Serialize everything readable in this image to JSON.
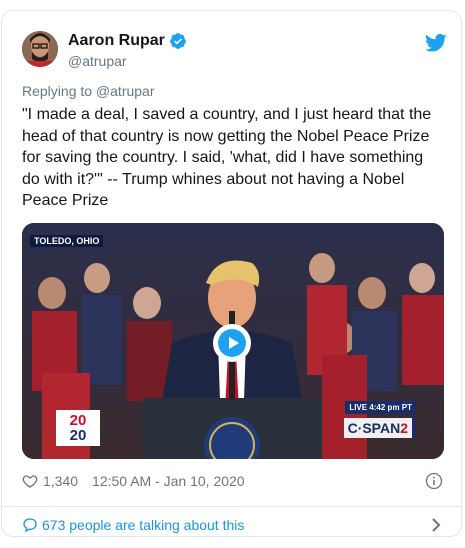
{
  "tweet": {
    "author_name": "Aaron Rupar",
    "author_handle": "@atrupar",
    "replying_to": "Replying to @atrupar",
    "text": "\"I made a deal, I saved a country, and I just heard that the head of that country is now getting the Nobel Peace Prize for saving the country. I said, 'what, did I have something do with it?'\" -- Trump whines about not having a Nobel Peace Prize",
    "likes": "1,340",
    "timestamp": "12:50 AM - Jan 10, 2020",
    "talking_link": "673 people are talking about this"
  },
  "media": {
    "location_label": "TOLEDO, OHIO",
    "live_label": "LIVE  4:42 pm PT",
    "network_main": "C·SPAN",
    "network_num": "2",
    "campaign_logo_top": "20",
    "campaign_logo_bottom": "20"
  },
  "icons": {
    "verified": "verified-badge-icon",
    "brand": "twitter-bird-icon",
    "like": "heart-icon",
    "info": "info-icon",
    "conversation": "speech-bubble-icon",
    "more": "chevron-right-icon",
    "play": "play-icon"
  },
  "colors": {
    "twitter_blue": "#1da1f2",
    "link_blue": "#1b95e0",
    "muted": "#657786",
    "border": "#e1e8ed"
  }
}
